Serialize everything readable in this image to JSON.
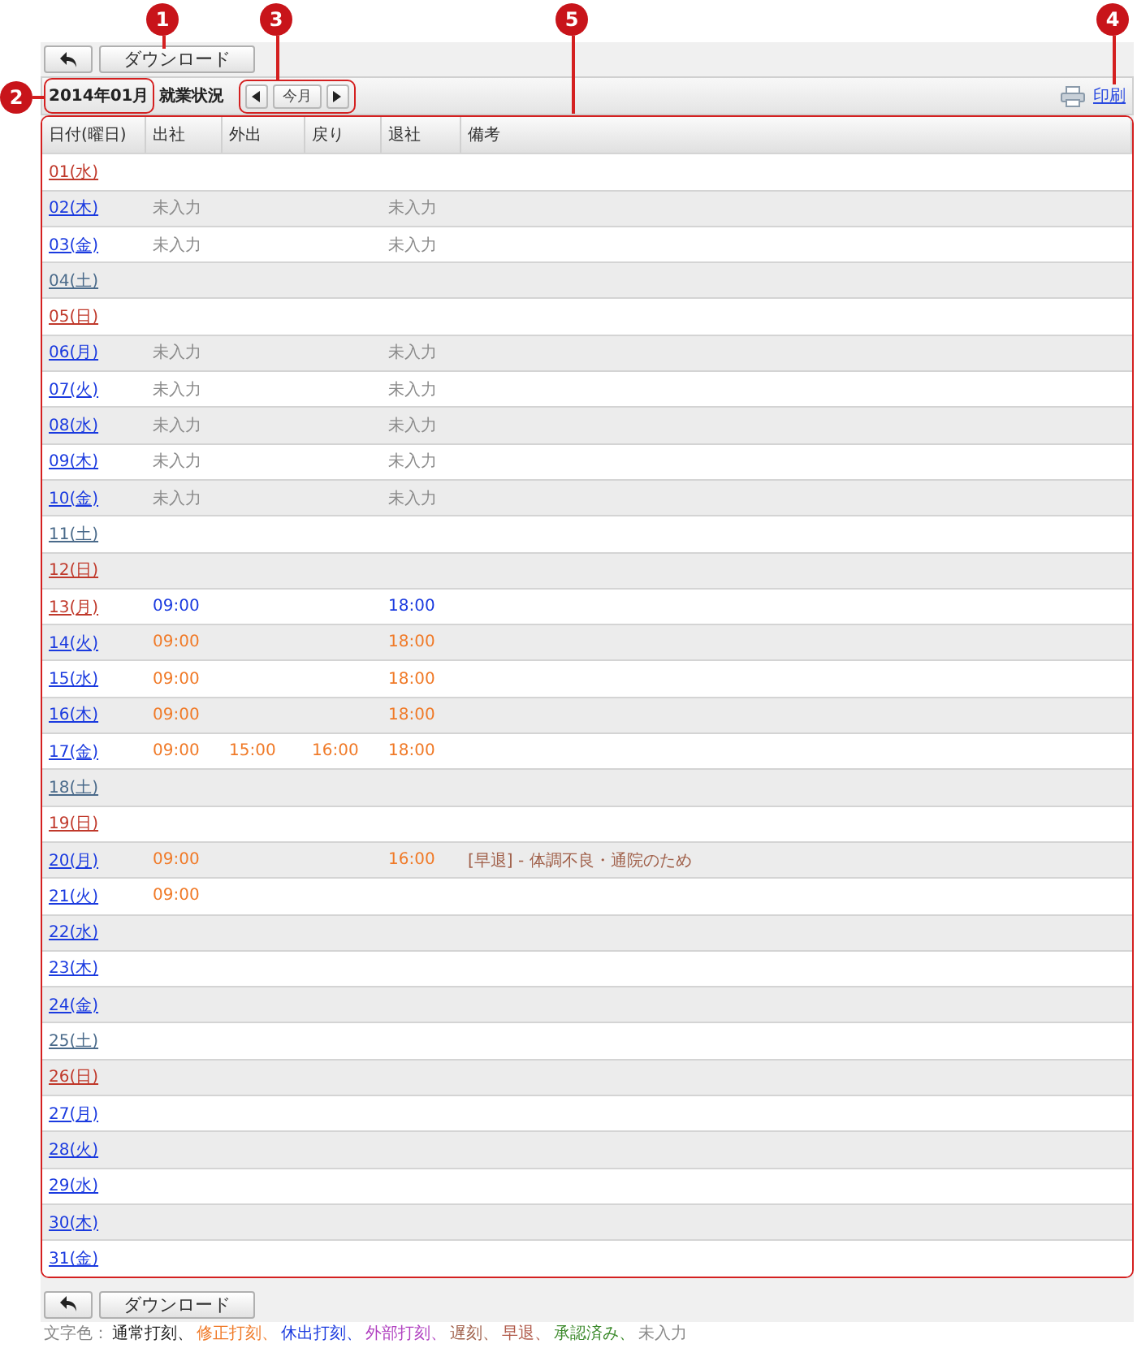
{
  "toolbar_top": {
    "download": "ダウンロード"
  },
  "header": {
    "month": "2014年01月",
    "title": "就業状況",
    "current_month": "今月",
    "print": "印刷"
  },
  "table": {
    "columns": [
      "日付(曜日)",
      "出社",
      "外出",
      "戻り",
      "退社",
      "備考"
    ],
    "rows": [
      {
        "date": "01(水)",
        "color": "#c0392b"
      },
      {
        "date": "02(木)",
        "color": "#1a3adf",
        "clock_in": {
          "text": "未入力",
          "color": "#8a8a8a"
        },
        "clock_out": {
          "text": "未入力",
          "color": "#8a8a8a"
        }
      },
      {
        "date": "03(金)",
        "color": "#1a3adf",
        "clock_in": {
          "text": "未入力",
          "color": "#8a8a8a"
        },
        "clock_out": {
          "text": "未入力",
          "color": "#8a8a8a"
        }
      },
      {
        "date": "04(土)",
        "color": "#4a6a8a"
      },
      {
        "date": "05(日)",
        "color": "#c0392b"
      },
      {
        "date": "06(月)",
        "color": "#1a3adf",
        "clock_in": {
          "text": "未入力",
          "color": "#8a8a8a"
        },
        "clock_out": {
          "text": "未入力",
          "color": "#8a8a8a"
        }
      },
      {
        "date": "07(火)",
        "color": "#1a3adf",
        "clock_in": {
          "text": "未入力",
          "color": "#8a8a8a"
        },
        "clock_out": {
          "text": "未入力",
          "color": "#8a8a8a"
        }
      },
      {
        "date": "08(水)",
        "color": "#1a3adf",
        "clock_in": {
          "text": "未入力",
          "color": "#8a8a8a"
        },
        "clock_out": {
          "text": "未入力",
          "color": "#8a8a8a"
        }
      },
      {
        "date": "09(木)",
        "color": "#1a3adf",
        "clock_in": {
          "text": "未入力",
          "color": "#8a8a8a"
        },
        "clock_out": {
          "text": "未入力",
          "color": "#8a8a8a"
        }
      },
      {
        "date": "10(金)",
        "color": "#1a3adf",
        "clock_in": {
          "text": "未入力",
          "color": "#8a8a8a"
        },
        "clock_out": {
          "text": "未入力",
          "color": "#8a8a8a"
        }
      },
      {
        "date": "11(土)",
        "color": "#4a6a8a"
      },
      {
        "date": "12(日)",
        "color": "#c0392b"
      },
      {
        "date": "13(月)",
        "color": "#c0392b",
        "clock_in": {
          "text": "09:00",
          "color": "#1a3adf"
        },
        "clock_out": {
          "text": "18:00",
          "color": "#1a3adf"
        }
      },
      {
        "date": "14(火)",
        "color": "#1a3adf",
        "clock_in": {
          "text": "09:00",
          "color": "#f07a28"
        },
        "clock_out": {
          "text": "18:00",
          "color": "#f07a28"
        }
      },
      {
        "date": "15(水)",
        "color": "#1a3adf",
        "clock_in": {
          "text": "09:00",
          "color": "#f07a28"
        },
        "clock_out": {
          "text": "18:00",
          "color": "#f07a28"
        }
      },
      {
        "date": "16(木)",
        "color": "#1a3adf",
        "clock_in": {
          "text": "09:00",
          "color": "#f07a28"
        },
        "clock_out": {
          "text": "18:00",
          "color": "#f07a28"
        }
      },
      {
        "date": "17(金)",
        "color": "#1a3adf",
        "clock_in": {
          "text": "09:00",
          "color": "#f07a28"
        },
        "go_out": {
          "text": "15:00",
          "color": "#f07a28"
        },
        "back": {
          "text": "16:00",
          "color": "#f07a28"
        },
        "clock_out": {
          "text": "18:00",
          "color": "#f07a28"
        }
      },
      {
        "date": "18(土)",
        "color": "#4a6a8a"
      },
      {
        "date": "19(日)",
        "color": "#c0392b"
      },
      {
        "date": "20(月)",
        "color": "#1a3adf",
        "clock_in": {
          "text": "09:00",
          "color": "#f07a28"
        },
        "clock_out": {
          "text": "16:00",
          "color": "#f07a28"
        },
        "note": {
          "text": "[早退] - 体調不良・通院のため",
          "color": "#a0604a"
        }
      },
      {
        "date": "21(火)",
        "color": "#1a3adf",
        "clock_in": {
          "text": "09:00",
          "color": "#f07a28"
        }
      },
      {
        "date": "22(水)",
        "color": "#1a3adf"
      },
      {
        "date": "23(木)",
        "color": "#1a3adf"
      },
      {
        "date": "24(金)",
        "color": "#1a3adf"
      },
      {
        "date": "25(土)",
        "color": "#4a6a8a"
      },
      {
        "date": "26(日)",
        "color": "#c0392b"
      },
      {
        "date": "27(月)",
        "color": "#1a3adf"
      },
      {
        "date": "28(火)",
        "color": "#1a3adf"
      },
      {
        "date": "29(水)",
        "color": "#1a3adf"
      },
      {
        "date": "30(木)",
        "color": "#1a3adf"
      },
      {
        "date": "31(金)",
        "color": "#1a3adf"
      }
    ]
  },
  "toolbar_bottom": {
    "download": "ダウンロード"
  },
  "legend": {
    "label": "文字色：",
    "items": [
      {
        "text": "通常打刻、",
        "color": "#222222"
      },
      {
        "text": "修正打刻、",
        "color": "#f07a28"
      },
      {
        "text": "休出打刻、",
        "color": "#1a3adf"
      },
      {
        "text": "外部打刻、",
        "color": "#b040c0"
      },
      {
        "text": "遅刻、",
        "color": "#a0604a"
      },
      {
        "text": "早退、",
        "color": "#b05a4a"
      },
      {
        "text": "承認済み、",
        "color": "#3c8a2c"
      },
      {
        "text": "未入力",
        "color": "#8a8a8a"
      }
    ]
  },
  "callouts": [
    {
      "label": "1"
    },
    {
      "label": "3"
    },
    {
      "label": "5"
    },
    {
      "label": "4"
    },
    {
      "label": "2"
    }
  ]
}
